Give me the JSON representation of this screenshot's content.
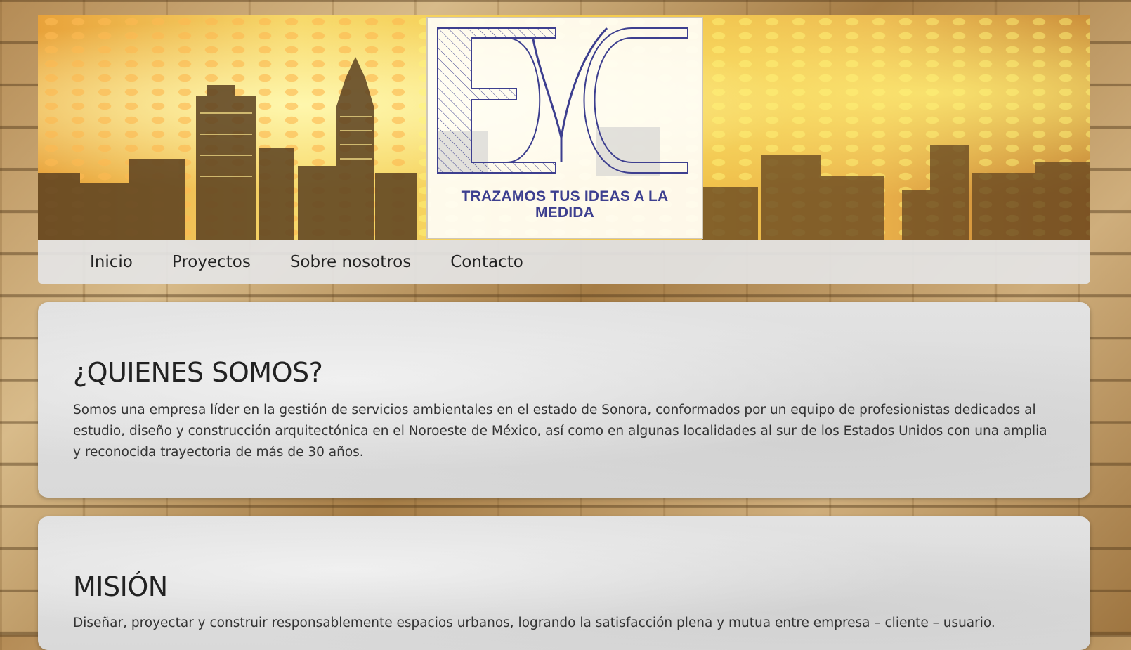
{
  "banner": {
    "tagline_line1": "TRAZAMOS TUS IDEAS A LA",
    "tagline_line2": "MEDIDA",
    "logo_letters": "EYC"
  },
  "nav": {
    "items": [
      {
        "label": "Inicio"
      },
      {
        "label": "Proyectos"
      },
      {
        "label": "Sobre nosotros"
      },
      {
        "label": "Contacto"
      }
    ]
  },
  "sections": [
    {
      "title": "¿QUIENES SOMOS?",
      "body": "Somos una empresa líder en la gestión de servicios ambientales en el estado de Sonora, conformados por un equipo de profesionistas dedicados al estudio, diseño y construcción arquitectónica en el Noroeste de México, así como en algunas localidades al sur de los Estados Unidos con una amplia y reconocida trayectoria de más de 30 años."
    },
    {
      "title": "MISIÓN",
      "body": "Diseñar, proyectar y construir responsablemente espacios urbanos, logrando la satisfacción plena y mutua entre empresa – cliente – usuario."
    }
  ],
  "colors": {
    "logo_ink": "#3d3f8f",
    "nav_bg": "#e4e4e4",
    "card_bg": "#dedede"
  }
}
